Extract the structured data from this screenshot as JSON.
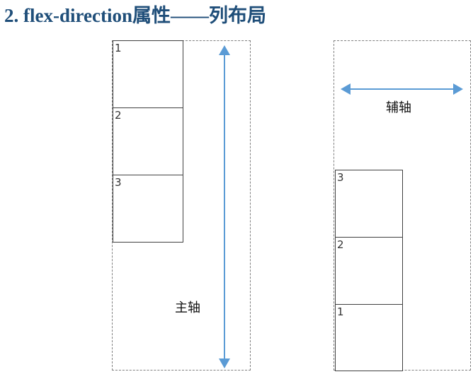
{
  "title": "2. flex-direction属性——列布局",
  "left_items": [
    {
      "label": "1"
    },
    {
      "label": "2"
    },
    {
      "label": "3"
    }
  ],
  "right_items": [
    {
      "label": "3"
    },
    {
      "label": "2"
    },
    {
      "label": "1"
    }
  ],
  "main_axis_label": "主轴",
  "cross_axis_label": "辅轴",
  "colors": {
    "title": "#1f4e79",
    "arrow": "#5b9bd5",
    "item_border": "#404040",
    "container_border": "#7f7f7f"
  }
}
